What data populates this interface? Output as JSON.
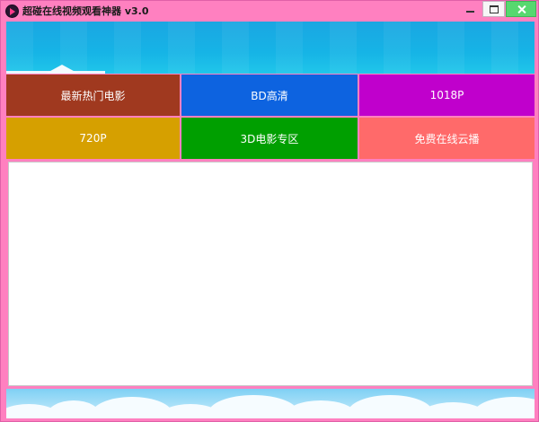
{
  "window": {
    "title": "超碰在线视频观看神器 v3.0",
    "icon": "play-icon"
  },
  "colors": {
    "frame": "#ff80c0",
    "banner": "#1aa6e2",
    "close": "#57d86f"
  },
  "tiles": [
    {
      "label": "最新热门电影",
      "color": "#a0391f"
    },
    {
      "label": "BD高清",
      "color": "#0d63e0"
    },
    {
      "label": "1018P",
      "color": "#c000cc"
    },
    {
      "label": "720P",
      "color": "#d6a000"
    },
    {
      "label": "3D电影专区",
      "color": "#009f00"
    },
    {
      "label": "免费在线云播",
      "color": "#ff6a6a"
    }
  ]
}
